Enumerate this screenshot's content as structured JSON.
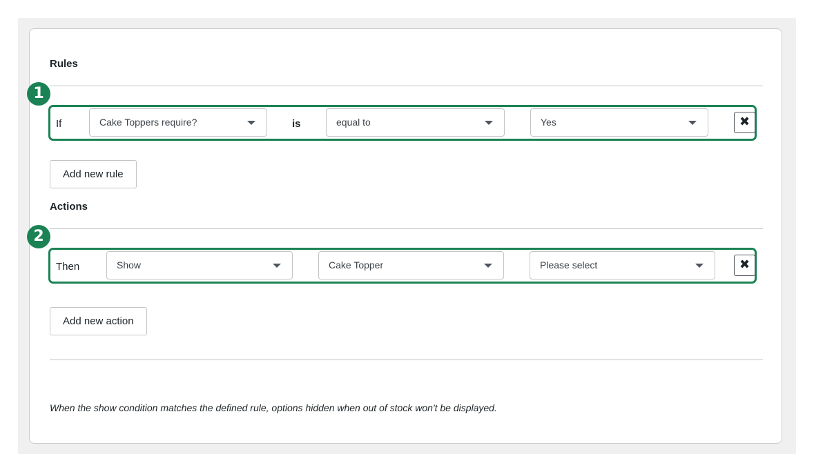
{
  "rules": {
    "heading": "Rules",
    "badge": "1",
    "row": {
      "if_label": "If",
      "field_select": "Cake Toppers require?",
      "is_label": "is",
      "operator_select": "equal to",
      "value_select": "Yes",
      "delete_icon": "✖"
    },
    "add_button": "Add new rule"
  },
  "actions": {
    "heading": "Actions",
    "badge": "2",
    "row": {
      "then_label": "Then",
      "action_select": "Show",
      "target_select": "Cake Topper",
      "option_select": "Please select",
      "delete_icon": "✖"
    },
    "add_button": "Add new action"
  },
  "note": "When the show condition matches the defined rule, options hidden when out of stock won't be displayed.",
  "colors": {
    "accent": "#1a8254",
    "border": "#c3c4c7",
    "background": "#f0f0f1"
  }
}
